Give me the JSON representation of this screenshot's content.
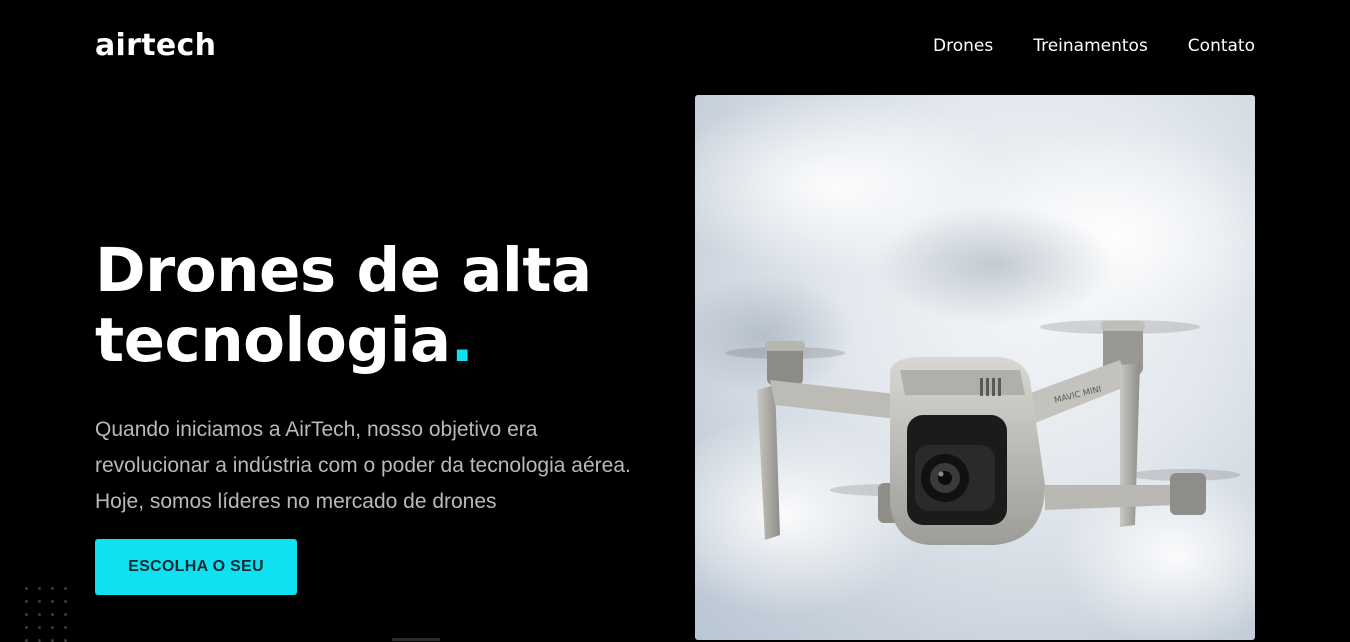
{
  "header": {
    "logo": "airtech",
    "nav": [
      {
        "label": "Drones"
      },
      {
        "label": "Treinamentos"
      },
      {
        "label": "Contato"
      }
    ]
  },
  "hero": {
    "title_line1": "Drones de alta",
    "title_line2": "tecnologia",
    "title_dot": ".",
    "description": "Quando iniciamos a AirTech, nosso objetivo era revolucionar a indústria com o poder da tecnologia aérea. Hoje, somos líderes no mercado de drones",
    "cta_label": "ESCOLHA O SEU",
    "image_label": "MAVIC MINI"
  },
  "colors": {
    "background": "#000000",
    "accent": "#0ee2f1",
    "text": "#ffffff",
    "muted_text": "#b9b9b9"
  },
  "icons": {
    "image": "drone-photo",
    "decor": "dot-grid"
  }
}
